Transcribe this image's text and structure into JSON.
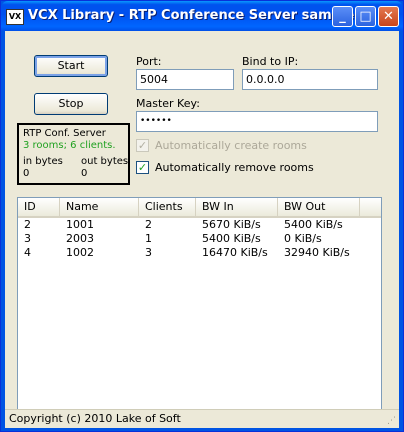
{
  "window": {
    "icon_text": "VX",
    "title": "VCX Library - RTP Conference Server sample"
  },
  "titlebar_buttons": {
    "minimize": "_",
    "maximize": "□",
    "close": "✕"
  },
  "controls": {
    "start_label": "Start",
    "stop_label": "Stop",
    "port_label": "Port:",
    "port_value": "5004",
    "bind_label": "Bind to IP:",
    "bind_value": "0.0.0.0",
    "master_key_label": "Master Key:",
    "master_key_value": "••••••",
    "auto_create_label": "Automatically create rooms",
    "auto_create_checked": true,
    "auto_create_enabled": false,
    "auto_remove_label": "Automatically remove rooms",
    "auto_remove_checked": true
  },
  "status_box": {
    "title": "RTP Conf. Server",
    "summary": "3 rooms; 6 clients.",
    "in_label": "in bytes",
    "out_label": "out bytes",
    "in_value": "0",
    "out_value": "0",
    "summary_color": "#21a121"
  },
  "table": {
    "columns": [
      "ID",
      "Name",
      "Clients",
      "BW In",
      "BW Out"
    ],
    "rows": [
      [
        "2",
        "1001",
        "2",
        "5670 KiB/s",
        "5400 KiB/s"
      ],
      [
        "3",
        "2003",
        "1",
        "5400 KiB/s",
        "0 KiB/s"
      ],
      [
        "4",
        "1002",
        "3",
        "16470 KiB/s",
        "32940 KiB/s"
      ]
    ]
  },
  "statusbar": {
    "text": "Copyright (c) 2010 Lake of Soft"
  }
}
